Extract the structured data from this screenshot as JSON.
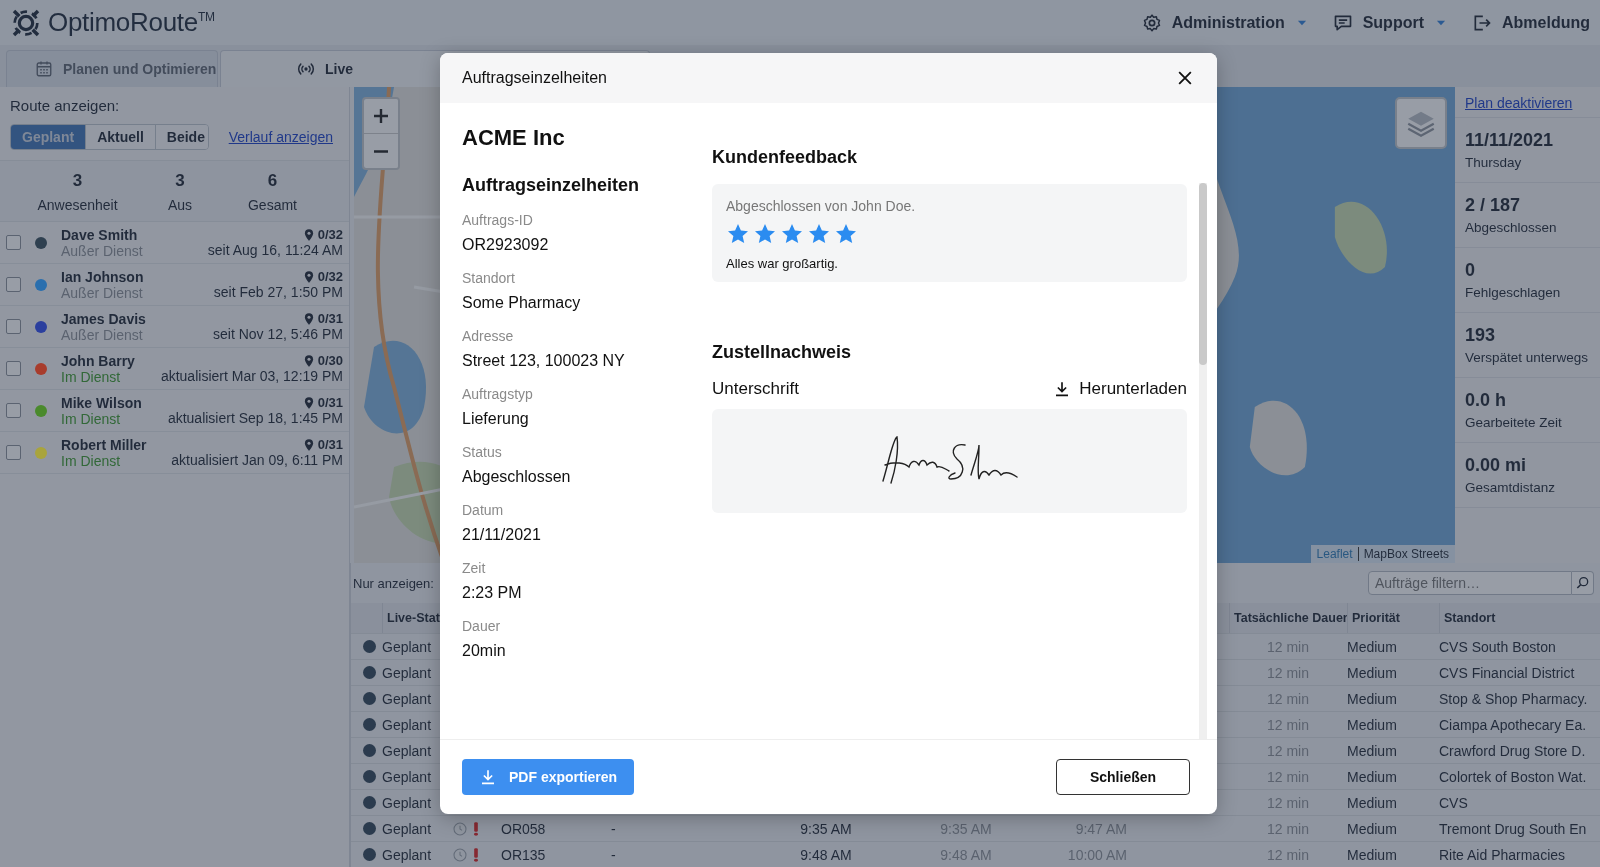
{
  "header": {
    "logo": "OptimoRoute$^{TM}$",
    "nav": [
      {
        "kind": "settings",
        "label": "Administration",
        "dropdown": true
      },
      {
        "kind": "support",
        "label": "Support",
        "dropdown": true
      },
      {
        "kind": "logout",
        "label": "Abmeldung",
        "dropdown": false
      }
    ]
  },
  "tabs": [
    {
      "kind": "plan",
      "label": "Planen und Optimieren",
      "selected": false
    },
    {
      "kind": "live",
      "label": "Live",
      "selected": true
    }
  ],
  "route_panel": {
    "label": "Route anzeigen:",
    "modes": [
      {
        "label": "Geplant",
        "selected": true
      },
      {
        "label": "Aktuell",
        "selected": false
      },
      {
        "label": "Beide",
        "selected": false
      }
    ],
    "history_link": "Verlauf anzeigen",
    "summary": [
      {
        "value": "3",
        "label": "Anwesenheit"
      },
      {
        "value": "3",
        "label": "Aus"
      },
      {
        "value": "6",
        "label": "Gesamt"
      }
    ],
    "drivers": [
      {
        "name": "Dave Smith",
        "status": "Außer Dienst",
        "on_duty": false,
        "checked": false,
        "color": "#2f4050",
        "orders": "0/32",
        "time": "seit Aug 16, 11:24 AM"
      },
      {
        "name": "Ian Johnson",
        "status": "Außer Dienst",
        "on_duty": false,
        "checked": false,
        "color": "#2a6fae",
        "orders": "0/32",
        "time": "seit Feb 27, 1:50 PM"
      },
      {
        "name": "James Davis",
        "status": "Außer Dienst",
        "on_duty": false,
        "checked": false,
        "color": "#2b3f9e",
        "orders": "0/31",
        "time": "seit Nov 12, 5:46 PM"
      },
      {
        "name": "John Barry",
        "status": "Im Dienst",
        "on_duty": true,
        "checked": false,
        "color": "#a83c2c",
        "orders": "0/30",
        "time": "aktualisiert Mar 03, 12:19 PM"
      },
      {
        "name": "Mike Wilson",
        "status": "Im Dienst",
        "on_duty": true,
        "checked": false,
        "color": "#4a8a2c",
        "orders": "0/31",
        "time": "aktualisiert Sep 18, 1:45 PM"
      },
      {
        "name": "Robert Miller",
        "status": "Im Dienst",
        "on_duty": true,
        "checked": false,
        "color": "#a9a43c",
        "orders": "0/31",
        "time": "aktualisiert Jan 09, 6:11 PM"
      }
    ]
  },
  "map": {
    "attribution_link": "Leaflet",
    "attribution": "MapBox Streets"
  },
  "stats_panel": {
    "link": "Plan deaktivieren",
    "items": [
      {
        "value": "11/11/2021",
        "label": "Thursday"
      },
      {
        "value": "2 / 187",
        "label": "Abgeschlossen"
      },
      {
        "value": "0",
        "label": "Fehlgeschlagen"
      },
      {
        "value": "193",
        "label": "Verspätet unterwegs"
      },
      {
        "value": "0.0 h",
        "label": "Gearbeitete Zeit"
      },
      {
        "value": "0.00 mi",
        "label": "Gesamtdistanz"
      }
    ]
  },
  "orders": {
    "filter_label": "Nur anzeigen:",
    "search": {
      "placeholder": "Aufträge filtern…"
    },
    "columns": [
      {
        "kind": "status",
        "label": "Live-Stat"
      },
      {
        "kind": "duration",
        "label": "Tatsächliche Dauer"
      },
      {
        "kind": "priority",
        "label": "Priorität"
      },
      {
        "kind": "location",
        "label": "Standort"
      }
    ],
    "rows": [
      {
        "status": "Geplant",
        "duration": "12 min",
        "priority": "Medium",
        "location": "CVS South Boston"
      },
      {
        "status": "Geplant",
        "duration": "12 min",
        "priority": "Medium",
        "location": "CVS Financial District"
      },
      {
        "status": "Geplant",
        "duration": "12 min",
        "priority": "Medium",
        "location": "Stop & Shop Pharmacy."
      },
      {
        "status": "Geplant",
        "duration": "12 min",
        "priority": "Medium",
        "location": "Ciampa Apothecary Ea."
      },
      {
        "status": "Geplant",
        "duration": "12 min",
        "priority": "Medium",
        "location": "Crawford Drug Store D."
      },
      {
        "status": "Geplant",
        "duration": "12 min",
        "priority": "Medium",
        "location": "Colortek of Boston Wat."
      },
      {
        "status": "Geplant",
        "duration": "12 min",
        "priority": "Medium",
        "location": "CVS"
      },
      {
        "status": "Geplant",
        "alert": true,
        "id": "OR058",
        "dash": "-",
        "planned": "9:35 AM",
        "scheduled": "9:35 AM",
        "end": "9:47 AM",
        "duration": "12 min",
        "priority": "Medium",
        "location": "Tremont Drug South En"
      },
      {
        "status": "Geplant",
        "alert": true,
        "id": "OR135",
        "dash": "-",
        "planned": "9:48 AM",
        "scheduled": "9:48 AM",
        "end": "10:00 AM",
        "duration": "12 min",
        "priority": "Medium",
        "location": "Rite Aid Pharmacies"
      }
    ]
  },
  "modal": {
    "title": "Auftragseinzelheiten",
    "customer": "ACME Inc",
    "section": "Auftragseinzelheiten",
    "fields": [
      {
        "label": "Auftrags-ID",
        "value": "OR2923092"
      },
      {
        "label": "Standort",
        "value": "Some Pharmacy"
      },
      {
        "label": "Adresse",
        "value": "Street 123, 100023 NY"
      },
      {
        "label": "Auftragstyp",
        "value": "Lieferung"
      },
      {
        "label": "Status",
        "value": "Abgeschlossen"
      },
      {
        "label": "Datum",
        "value": "21/11/2021"
      },
      {
        "label": "Zeit",
        "value": "2:23 PM"
      },
      {
        "label": "Dauer",
        "value": "20min"
      }
    ],
    "feedback": {
      "heading": "Kundenfeedback",
      "by": "Abgeschlossen von John Doe.",
      "stars": 5,
      "comment": "Alles war großartig."
    },
    "proof": {
      "heading": "Zustellnachweis",
      "signature_label": "Unterschrift",
      "download": "Herunterladen"
    },
    "buttons": [
      {
        "kind": "primary",
        "label": "PDF exportieren"
      },
      {
        "kind": "secondary",
        "label": "Schließen"
      }
    ]
  }
}
